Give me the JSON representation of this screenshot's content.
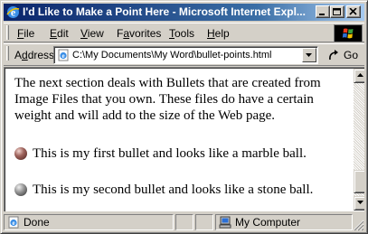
{
  "window": {
    "title": "I'd Like to Make a Point Here - Microsoft Internet Expl..."
  },
  "menu": {
    "items": [
      {
        "accel": "F",
        "rest": "ile"
      },
      {
        "accel": "E",
        "rest": "dit"
      },
      {
        "accel": "V",
        "rest": "iew"
      },
      {
        "accel": "",
        "pre": "F",
        "accel2": "a",
        "rest": "vorites"
      },
      {
        "accel": "T",
        "rest": "ools"
      },
      {
        "accel": "H",
        "rest": "elp"
      }
    ]
  },
  "address": {
    "label_accel": "d",
    "label_pre": "A",
    "label_rest": "dress",
    "url": "C:\\My Documents\\My Word\\bullet-points.html",
    "go_label": "Go"
  },
  "content": {
    "intro": "The next section deals with Bullets that are created from Image Files that you own. These files do have a certain weight and will add to the size of the Web page.",
    "bullets": [
      {
        "text": "This is my first bullet and looks like a marble ball.",
        "style": "marble"
      },
      {
        "text": "This is my second bullet and looks like a stone ball.",
        "style": "stone"
      }
    ]
  },
  "status": {
    "text": "Done",
    "zone": "My Computer"
  },
  "colors": {
    "titlebar_start": "#0a246a",
    "titlebar_end": "#a6caf0",
    "chrome": "#d4d0c8"
  }
}
